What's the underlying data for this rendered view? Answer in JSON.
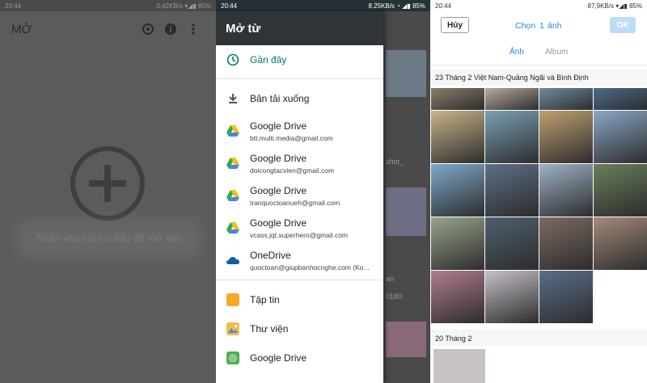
{
  "panel1": {
    "status_time": "20:44",
    "status_right": "0,42KB/s",
    "status_battery": "85%",
    "title": "MỞ",
    "icons": [
      "camera-rotate-icon",
      "info-icon",
      "overflow-menu-icon"
    ],
    "hint": "Nhấn vào bất cứ đâu để mở ảnh"
  },
  "panel2": {
    "status_time": "20:44",
    "status_right": "8,25KB/s",
    "status_battery": "85%",
    "drawer_title": "Mở từ",
    "items": [
      {
        "label": "Gần đây",
        "sub": "",
        "icon": "clock-icon",
        "active": true
      },
      {
        "label": "Bản tải xuống",
        "sub": "",
        "icon": "download-icon"
      },
      {
        "label": "Google Drive",
        "sub": "btt.multi.media@gmail.com",
        "icon": "google-drive-icon"
      },
      {
        "label": "Google Drive",
        "sub": "doicongtacvien@gmail.com",
        "icon": "google-drive-icon"
      },
      {
        "label": "Google Drive",
        "sub": "tranquoctoanueh@gmail.com",
        "icon": "google-drive-icon"
      },
      {
        "label": "Google Drive",
        "sub": "vcass.jqt.superhero@gmail.com",
        "icon": "google-drive-icon"
      },
      {
        "label": "OneDrive",
        "sub": "quoctoan@giupbanhocnghe.com (Ko...",
        "icon": "onedrive-icon"
      },
      {
        "label": "Tập tin",
        "sub": "",
        "icon": "files-icon"
      },
      {
        "label": "Thư viện",
        "sub": "",
        "icon": "gallery-icon"
      },
      {
        "label": "Google Drive",
        "sub": "",
        "icon": "google-drive-icon"
      }
    ],
    "background_fragments": [
      "shot_",
      "0180",
      "an"
    ]
  },
  "panel3": {
    "status_time": "20:44",
    "status_right": "87,9KB/s",
    "status_battery": "85%",
    "cancel_label": "Hủy",
    "select_label": "Chọn",
    "select_count": "1",
    "select_unit": "ảnh",
    "ok_label": "OK",
    "tabs": [
      "Ảnh",
      "Album"
    ],
    "sections": [
      {
        "title": "23 Tháng 2  Việt Nam-Quảng Ngãi và Bình Định"
      },
      {
        "title": "20 Tháng 2"
      }
    ],
    "photo_colors": [
      "#8a7d6b",
      "#b9a8a0",
      "#6e8aa0",
      "#4c6b8c",
      "#c9b48a",
      "#7aa0b5",
      "#c0a070",
      "#8aa7c8",
      "#7fa9c9",
      "#5d6f84",
      "#9db2c8",
      "#6a7f5a",
      "#98a38a",
      "#4f5f6e",
      "#7b6a62",
      "#a48a7a",
      "#b07c8f",
      "#c6c0c8",
      "#5a6e8a"
    ]
  }
}
